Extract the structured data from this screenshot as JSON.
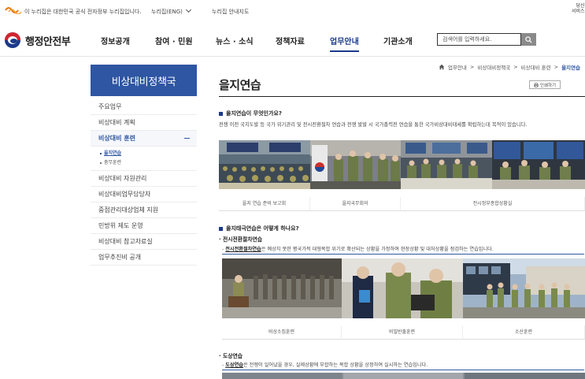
{
  "topbar": {
    "gov_notice": "이 누리집은 대한민국 공식 전자정부 누리집입니다.",
    "eng_link": "누리집(ENG)",
    "guide_link": "누리집 안내지도",
    "corner_text": "당신\n서비스"
  },
  "header": {
    "logo_name": "행정안전부",
    "nav": [
      "정보공개",
      "참여 · 민원",
      "뉴스 · 소식",
      "정책자료",
      "업무안내",
      "기관소개"
    ],
    "active_nav": "업무안내",
    "search_placeholder": "검색어를 입력하세요."
  },
  "sidebar": {
    "title": "비상대비정책국",
    "items": [
      "주요업무",
      "비상대비 계획",
      "비상대비 훈련",
      "비상대비 자원관리",
      "비상대비업무담당자",
      "중점관리대상업체 지원",
      "민방위 제도 운영",
      "비상대비 참고자료실",
      "업무추진비 공개"
    ],
    "open_item": "비상대비 훈련",
    "subitems": [
      "을지연습",
      "충무훈련"
    ],
    "current_sub": "을지연습"
  },
  "breadcrumb": [
    "업무안내",
    "비상대비정책국",
    "비상대비 훈련",
    "을지연습"
  ],
  "page": {
    "title": "을지연습",
    "print_label": "인쇄하기"
  },
  "section1": {
    "heading": "을지연습이 무엇인가요?",
    "text": "전쟁 이전 국지도발 등 국가 위기관리 및 전시전환절차 연습과 전쟁 발발 시 국가총력전 연습을 통한 국가비상대비태세를 확립하는데 목적이 있습니다.",
    "captions": [
      "을지 연습 준비 보고회",
      "을지국무회의",
      "전시정부종합상황실"
    ]
  },
  "section2": {
    "heading": "을지태극연습은 어떻게 하나요?",
    "sub1_title": "· 전시전환절차연습",
    "sub1_bold": "전시전환절차연습",
    "sub1_text": "은 예상치 못한 평국가적 대형복합 위기로 확산되는 상황을 가정하여 현장상황 및 대처상황을 점검하는 연습입니다.",
    "captions": [
      "비상소집훈련",
      "비밀반출훈련",
      "소산훈련"
    ],
    "sub2_title": "· 도상연습",
    "sub2_bold": "도상연습",
    "sub2_text": "은 전쟁이 일어났을 경우, 실제상황에 부합하는 복합 상황을 상정하여 실시하는 연습입니다."
  },
  "icons": {
    "search": "search-icon",
    "home": "home-icon",
    "print": "printer-icon",
    "minus": "minus-icon",
    "gov_logo": "gov-mark-icon"
  },
  "colors": {
    "brand": "#1b3a8a",
    "sidebar_title_bg": "#2f56a3",
    "gov_mark": "#e8740c"
  }
}
